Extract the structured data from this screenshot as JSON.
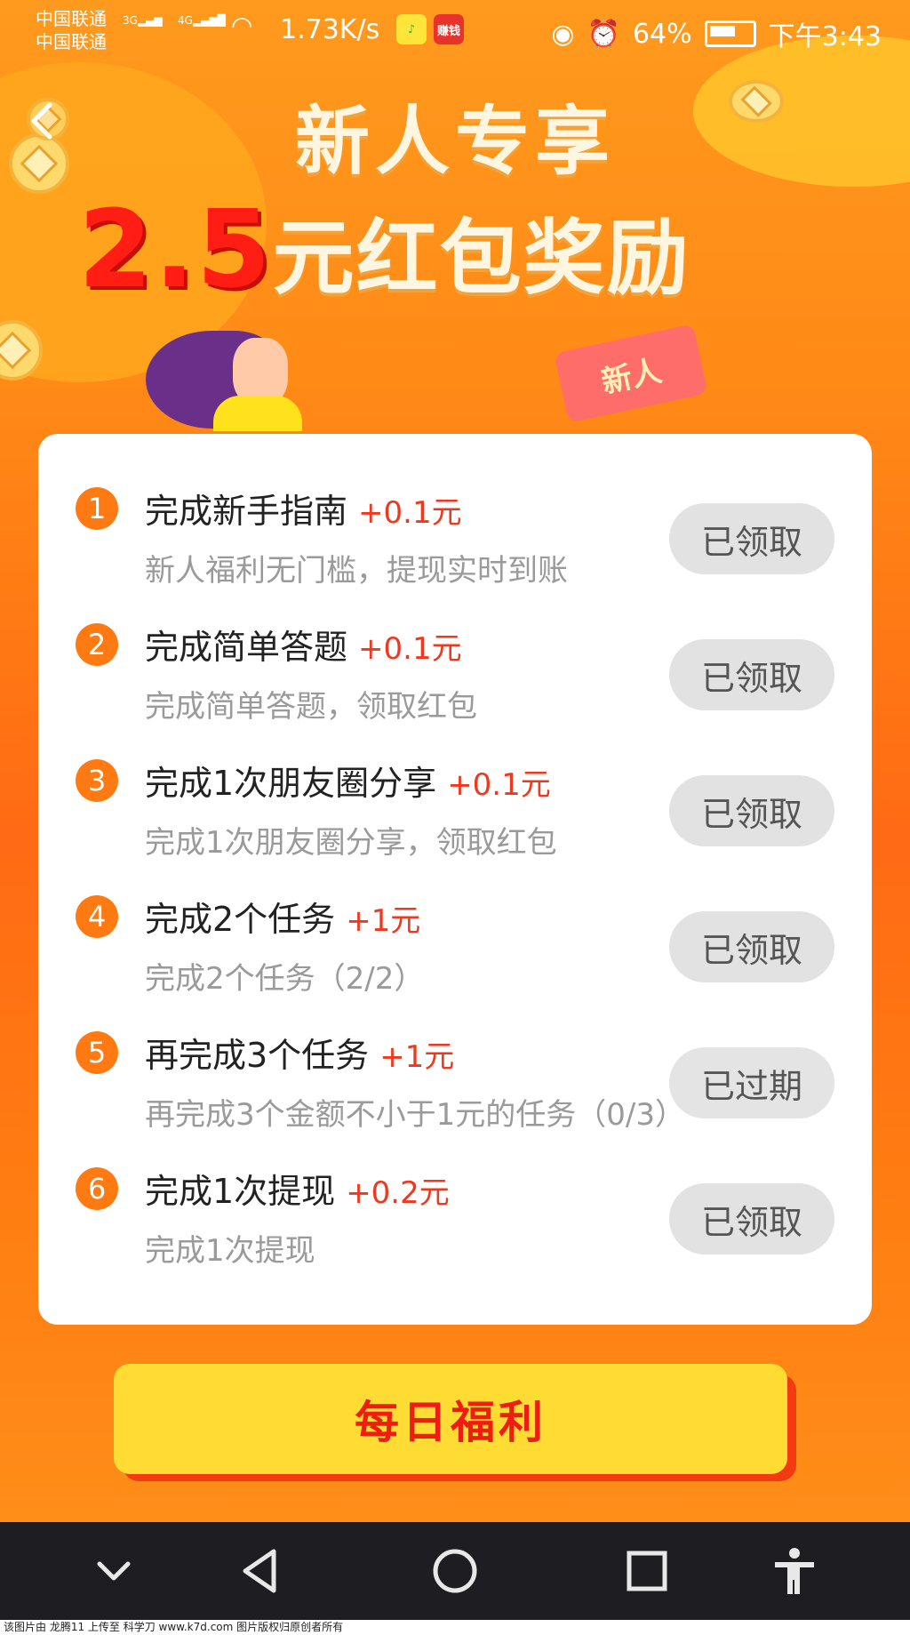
{
  "status_bar": {
    "carrier1": "中国联通",
    "carrier2": "中国联通",
    "sig1": "3G",
    "sig2": "4G",
    "speed": "1.73K/s",
    "app_icon_label": "赚钱",
    "battery": "64%",
    "time": "下午3:43"
  },
  "header": {
    "title": "新人专享",
    "amount": "2.5",
    "subtitle": "元红包奖励",
    "envelope_text": "新人"
  },
  "tasks": [
    {
      "num": "1",
      "title": "完成新手指南",
      "reward": "+0.1元",
      "desc": "新人福利无门槛，提现实时到账",
      "button": "已领取"
    },
    {
      "num": "2",
      "title": "完成简单答题",
      "reward": "+0.1元",
      "desc": "完成简单答题，领取红包",
      "button": "已领取"
    },
    {
      "num": "3",
      "title": "完成1次朋友圈分享",
      "reward": "+0.1元",
      "desc": "完成1次朋友圈分享，领取红包",
      "button": "已领取"
    },
    {
      "num": "4",
      "title": "完成2个任务",
      "reward": "+1元",
      "desc": "完成2个任务（2/2）",
      "button": "已领取"
    },
    {
      "num": "5",
      "title": "再完成3个任务",
      "reward": "+1元",
      "desc": "再完成3个金额不小于1元的任务（0/3）",
      "button": "已过期"
    },
    {
      "num": "6",
      "title": "完成1次提现",
      "reward": "+0.2元",
      "desc": "完成1次提现",
      "button": "已领取"
    }
  ],
  "daily_button": "每日福利",
  "footer": "该图片由 龙腾11 上传至 科学刀 www.k7d.com 图片版权归原创者所有",
  "colors": {
    "accent": "#ff7a12",
    "reward": "#f0381e",
    "amount_red": "#ff1d14",
    "daily_bg": "#ffdc34"
  }
}
